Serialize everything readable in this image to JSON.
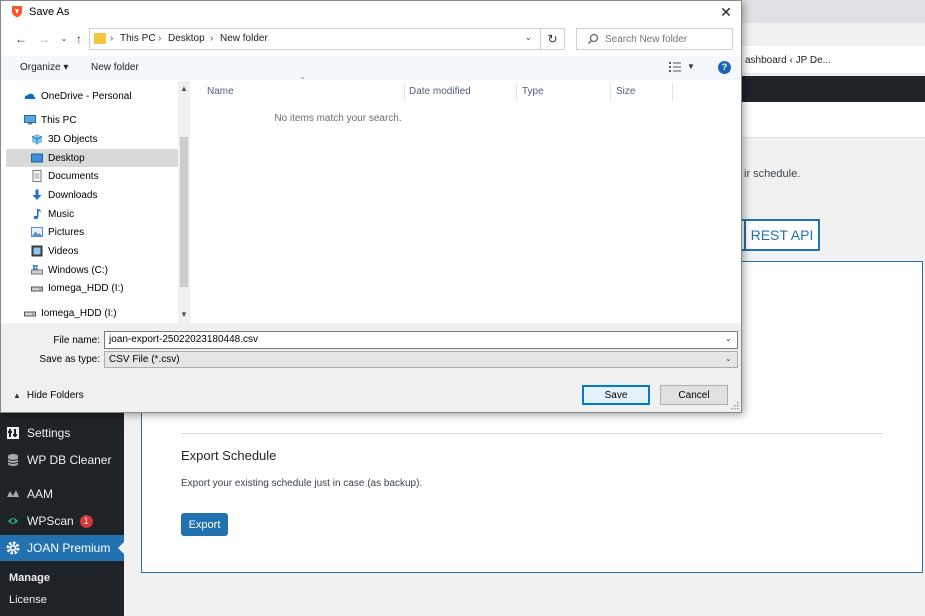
{
  "background": {
    "bookmark_text": "ashboard ‹ JP De...",
    "schedule_text": "ir schedule.",
    "tab_label": "REST API",
    "sidebar": {
      "items": [
        {
          "label": "Settings",
          "icon": "settings-icon"
        },
        {
          "label": "WP DB Cleaner",
          "icon": "database-icon"
        },
        {
          "label": "AAM",
          "icon": "aam-icon"
        },
        {
          "label": "WPScan",
          "icon": "wpscan-icon",
          "badge": "1"
        },
        {
          "label": "JOAN Premium",
          "icon": "gear-icon",
          "active": true
        }
      ],
      "submenu": [
        "Manage",
        "License"
      ]
    },
    "export": {
      "title": "Export Schedule",
      "description": "Export your existing schedule just in case (as backup).",
      "button": "Export"
    },
    "colors": {
      "admin_dark": "#1d2327",
      "accent": "#2271b1",
      "badge": "#d63638"
    }
  },
  "dialog": {
    "title": "Save As",
    "close_symbol": "✕",
    "address": [
      "This PC",
      "Desktop",
      "New folder"
    ],
    "search_placeholder": "Search New folder",
    "toolbar": {
      "organize": "Organize ▾",
      "new_folder": "New folder",
      "help": "?"
    },
    "nav_items": [
      {
        "label": "OneDrive - Personal",
        "icon": "onedrive-icon"
      },
      {
        "label": "This PC",
        "icon": "pc-icon"
      },
      {
        "label": "3D Objects",
        "icon": "3d-objects-icon"
      },
      {
        "label": "Desktop",
        "icon": "desktop-icon",
        "selected": true
      },
      {
        "label": "Documents",
        "icon": "documents-icon"
      },
      {
        "label": "Downloads",
        "icon": "downloads-icon"
      },
      {
        "label": "Music",
        "icon": "music-icon"
      },
      {
        "label": "Pictures",
        "icon": "pictures-icon"
      },
      {
        "label": "Videos",
        "icon": "videos-icon"
      },
      {
        "label": "Windows (C:)",
        "icon": "drive-c-icon"
      },
      {
        "label": "Iomega_HDD (I:)",
        "icon": "drive-icon"
      },
      {
        "label": "Iomega_HDD (I:)",
        "icon": "drive-icon"
      }
    ],
    "columns": [
      "Name",
      "Date modified",
      "Type",
      "Size"
    ],
    "empty_message": "No items match your search.",
    "file_name_label": "File name:",
    "file_name_value": "joan-export-25022023180448.csv",
    "save_as_type_label": "Save as type:",
    "save_as_type_value": "CSV File (*.csv)",
    "hide_folders": "Hide Folders",
    "save_button": "Save",
    "cancel_button": "Cancel"
  }
}
